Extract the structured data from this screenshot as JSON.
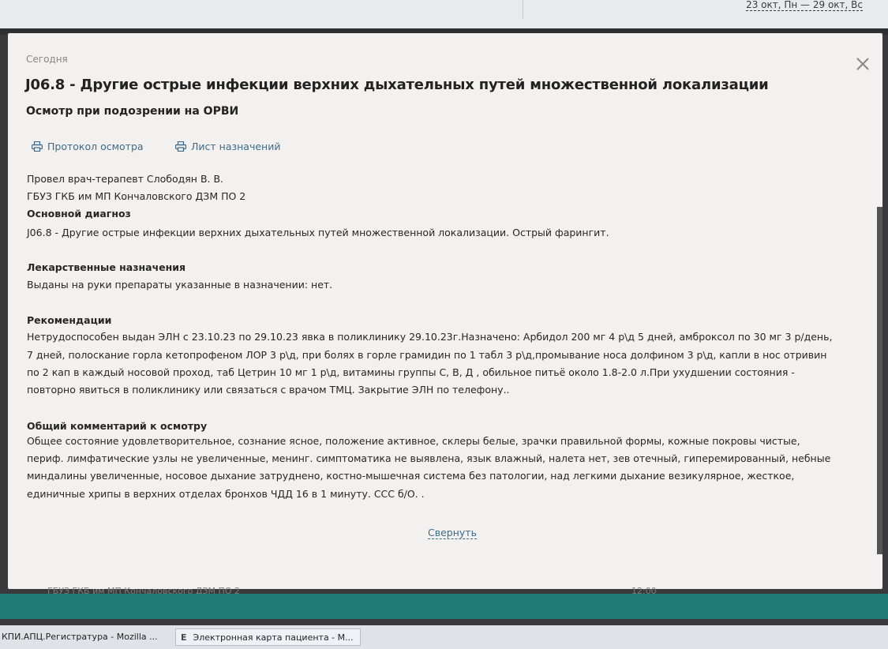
{
  "header": {
    "date_range": "23 окт, Пн — 29 окт, Вс"
  },
  "modal": {
    "today_label": "Сегодня",
    "title": "J06.8 - Другие острые инфекции верхних дыхательных путей множественной локализации",
    "subtitle": "Осмотр при подозрении на ОРВИ",
    "links": {
      "protocol": "Протокол осмотра",
      "prescriptions": "Лист назначений"
    },
    "doctor": "Провел врач-терапевт Слободян В. В.",
    "clinic": "ГБУЗ ГКБ им МП Кончаловского ДЗМ ПО 2",
    "main_diagnosis_heading": "Основной диагноз",
    "main_diagnosis": "J06.8 - Другие острые инфекции верхних дыхательных путей множественной локализации. Острый фарингит.",
    "drug_heading": "Лекарственные назначения",
    "drug_text": "Выданы на руки препараты указанные в назначении: нет.",
    "rec_heading": "Рекомендации",
    "rec_lines": [
      "Нетрудоспособен выдан ЭЛН с 23.10.23 по 29.10.23 явка в поликлинику 29.10.23г.Назначено: Арбидол 200 мг 4 р\\д 5 дней,  амброксол по 30 мг 3 р/день,",
      "7 дней, полоскание горла кетопрофеном ЛОР 3 р\\д, при болях в горле грамидин по 1 табл 3 р\\д,промывание носа долфином 3 р\\д,  капли в нос отривин",
      "по 2 кап в каждый носовой  проход,  таб Цетрин 10 мг 1 р\\д, витамины группы  С, В, Д , обильное питьё около 1.8-2.0 л.При ухудшении состояния -",
      "повторно явиться в поликлинику или связаться с врачом ТМЦ. Закрытие ЭЛН по телефону.."
    ],
    "comment_heading": "Общий комментарий к осмотру",
    "comment_lines": [
      "Общее состояние удовлетворительное, сознание ясное, положение активное, склеры белые,  зрачки правильной формы,  кожные покровы чистые,",
      "периф. лимфатические узлы не увеличенные, менинг. симптоматика не выявлена, язык влажный, налета нет, зев отечный, гиперемированный, небные",
      "миндалины увеличенные, носовое  дыхание  затруднено, костно-мышечная система без патологии, над легкими дыхание везикулярное, жесткое,",
      "единичные хрипы в верхних отделах бронхов  ЧДД 16 в 1 минуту.  ССС б/О. ."
    ],
    "collapse_label": "Свернуть"
  },
  "background": {
    "ghost_clinic": "ГБУЗ ГКБ им МП Кончаловского ДЗМ ПО 2",
    "ghost_right": "12:00"
  },
  "taskbar": {
    "task1": "КПИ.АПЦ.Регистратура - Mozilla ...",
    "task2_icon": "E",
    "task2": "Электронная карта пациента - M..."
  }
}
